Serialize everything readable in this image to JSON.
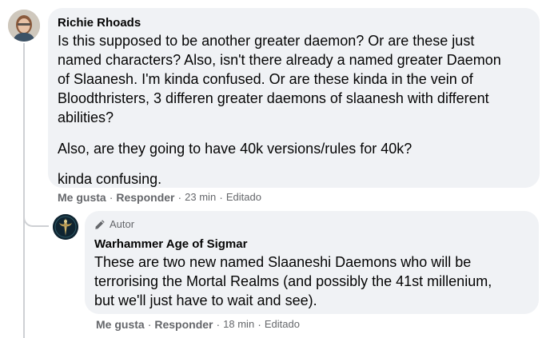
{
  "comments": [
    {
      "author": "Richie Rhoads",
      "avatar_icon": "user-avatar-photo",
      "paragraphs": [
        [
          "Is this supposed to be another greater daemon? Or are these just",
          "named characters? Also, isn't there already a named greater Daemon",
          "of Slaanesh. I'm kinda confused. Or are these kinda in the vein of",
          "Bloodthristers, 3 differen greater daemons of slaanesh with different",
          "abilities?"
        ],
        [
          "Also, are they going to have 40k versions/rules for 40k?"
        ],
        [
          "kinda confusing."
        ]
      ],
      "actions": {
        "like": "Me gusta",
        "reply": "Responder",
        "time": "23 min",
        "edited": "Editado"
      }
    },
    {
      "badge_icon": "pencil-icon",
      "badge": "Autor",
      "author": "Warhammer Age of Sigmar",
      "avatar_icon": "page-avatar-logo",
      "paragraphs": [
        [
          "These are two new named Slaaneshi Daemons who will be",
          "terrorising the Mortal Realms (and possibly the 41st millenium,",
          "but we'll just have to wait and see)."
        ]
      ],
      "actions": {
        "like": "Me gusta",
        "reply": "Responder",
        "time": "18 min",
        "edited": "Editado"
      }
    }
  ],
  "separators": {
    "dot": "·"
  },
  "colors": {
    "bubble": "#f0f2f5",
    "text": "#050505",
    "secondary": "#65676b",
    "thread_line": "#ced0d4"
  }
}
